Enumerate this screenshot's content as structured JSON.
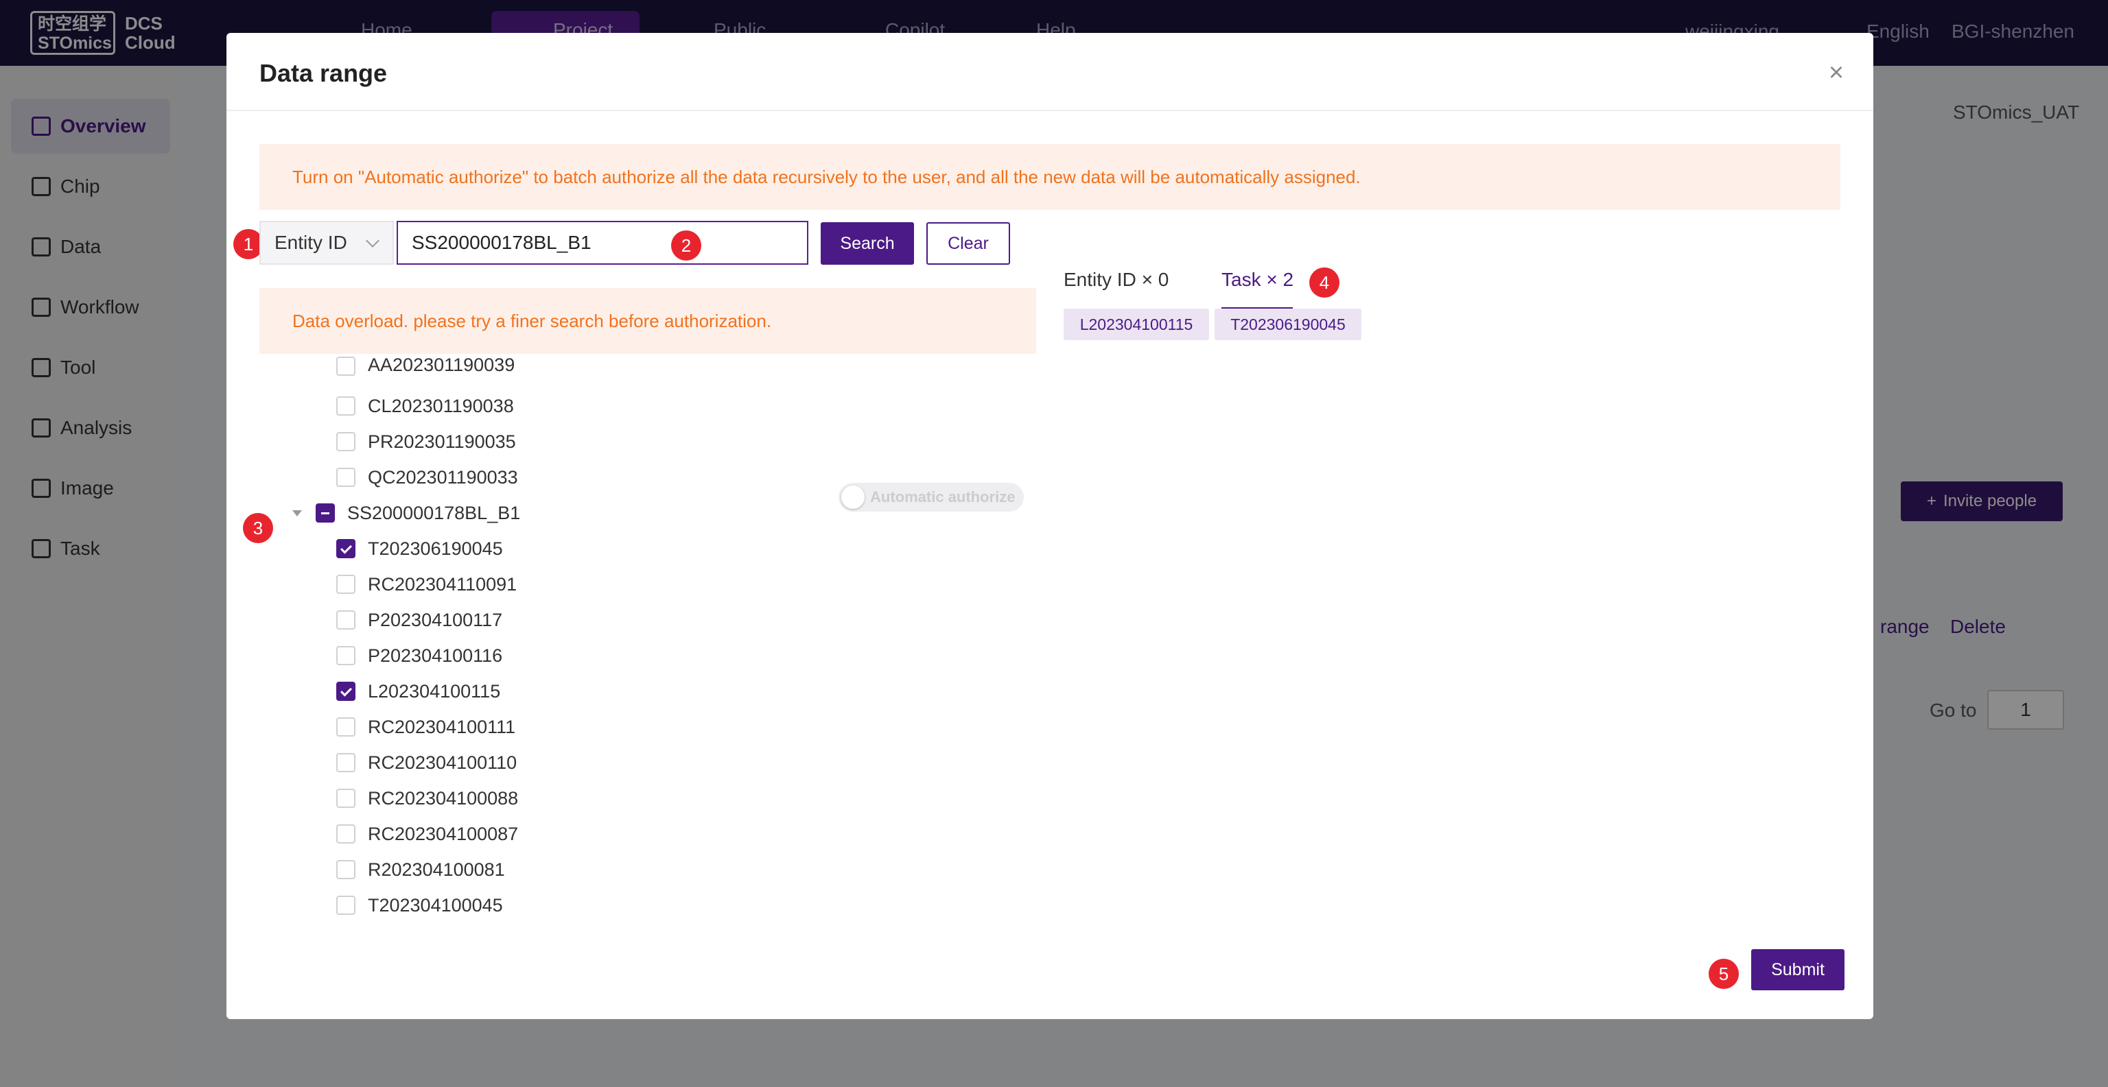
{
  "app": {
    "logo_cn": "时空组学",
    "logo_en": "STOmics",
    "logo_product_1": "DCS",
    "logo_product_2": "Cloud",
    "nav": [
      "Home",
      "Project",
      "Public",
      "Copilot",
      "Help"
    ],
    "user": "weijingxing",
    "language": "English",
    "org": "BGI-shenzhen"
  },
  "sidebar": {
    "items": [
      {
        "label": "Overview",
        "icon": "doc-icon"
      },
      {
        "label": "Chip",
        "icon": "chip-icon"
      },
      {
        "label": "Data",
        "icon": "file-icon"
      },
      {
        "label": "Workflow",
        "icon": "workflow-icon"
      },
      {
        "label": "Tool",
        "icon": "tool-icon"
      },
      {
        "label": "Analysis",
        "icon": "code-icon"
      },
      {
        "label": "Image",
        "icon": "image-icon"
      },
      {
        "label": "Task",
        "icon": "layers-icon"
      }
    ]
  },
  "background": {
    "project_name": "STOmics_UAT",
    "invite_button": "Invite people",
    "row_action_range": "range",
    "row_action_delete": "Delete",
    "goto_label": "Go to",
    "goto_value": "1"
  },
  "modal": {
    "title": "Data range",
    "close": "×",
    "notice": "Turn on \"Automatic authorize\" to batch authorize all the data recursively to the user, and all the new data will be automatically assigned.",
    "search_type": "Entity ID",
    "search_value": "SS200000178BL_B1",
    "search_button": "Search",
    "clear_button": "Clear",
    "overload_warning": "Data overload. please try a finer search before authorization.",
    "tree": {
      "above_items": [
        "AA202301190039",
        "CL202301190038",
        "PR202301190035",
        "QC202301190033"
      ],
      "parent": {
        "label": "SS200000178BL_B1",
        "state": "partial"
      },
      "auto_authorize_label": "Automatic authorize",
      "children": [
        {
          "label": "T202306190045",
          "checked": true
        },
        {
          "label": "RC202304110091",
          "checked": false
        },
        {
          "label": "P202304100117",
          "checked": false
        },
        {
          "label": "P202304100116",
          "checked": false
        },
        {
          "label": "L202304100115",
          "checked": true
        },
        {
          "label": "RC202304100111",
          "checked": false
        },
        {
          "label": "RC202304100110",
          "checked": false
        },
        {
          "label": "RC202304100088",
          "checked": false
        },
        {
          "label": "RC202304100087",
          "checked": false
        },
        {
          "label": "R202304100081",
          "checked": false
        },
        {
          "label": "T202304100045",
          "checked": false
        }
      ]
    },
    "selected_tabs": [
      {
        "label": "Entity ID × 0",
        "active": false
      },
      {
        "label": "Task × 2",
        "active": true
      }
    ],
    "selected_tags": [
      "L202304100115",
      "T202306190045"
    ],
    "submit_button": "Submit",
    "step_badges": [
      "1",
      "2",
      "3",
      "4",
      "5"
    ]
  },
  "colors": {
    "primary": "#4b1a86",
    "topbar": "#1a1540",
    "warning_text": "#f0721e",
    "warning_bg": "#fef0e8",
    "badge": "#e8252f"
  }
}
